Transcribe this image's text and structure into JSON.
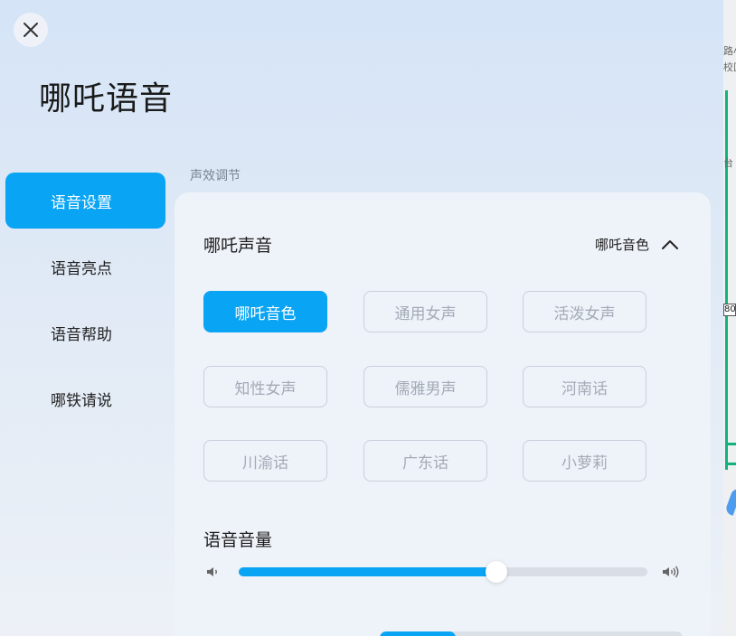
{
  "page": {
    "title": "哪吒语音"
  },
  "sidebar": {
    "items": [
      {
        "label": "语音设置",
        "active": true
      },
      {
        "label": "语音亮点",
        "active": false
      },
      {
        "label": "语音帮助",
        "active": false
      },
      {
        "label": "哪铁请说",
        "active": false
      }
    ]
  },
  "section": {
    "label": "声效调节"
  },
  "voice_card": {
    "title": "哪吒声音",
    "current_voice": "哪吒音色",
    "options": [
      {
        "label": "哪吒音色",
        "selected": true
      },
      {
        "label": "通用女声",
        "selected": false
      },
      {
        "label": "活泼女声",
        "selected": false
      },
      {
        "label": "知性女声",
        "selected": false
      },
      {
        "label": "儒雅男声",
        "selected": false
      },
      {
        "label": "河南话",
        "selected": false
      },
      {
        "label": "川渝话",
        "selected": false
      },
      {
        "label": "广东话",
        "selected": false
      },
      {
        "label": "小萝莉",
        "selected": false
      }
    ]
  },
  "volume": {
    "title": "语音音量",
    "level_fraction": 0.63
  },
  "map": {
    "label_text": "80",
    "snippets": [
      "路小",
      "校区",
      "台"
    ]
  },
  "colors": {
    "accent": "#0aa4f4",
    "map_road": "#12b37a"
  }
}
